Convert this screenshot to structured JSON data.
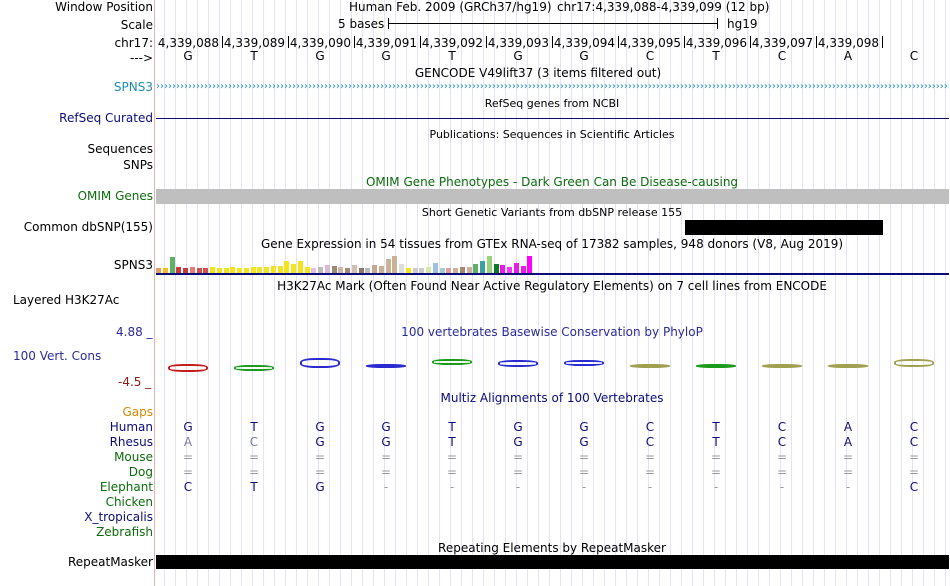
{
  "ruler": {
    "window_label": "Window Position",
    "assembly": "Human Feb. 2009 (GRCh37/hg19)",
    "position": "chr17:4,339,088-4,339,099 (12 bp)",
    "scale_label": "Scale",
    "scale_text": "5 bases",
    "scale_db": "hg19",
    "chrom_label": "chr17:",
    "coords": [
      "4,339,088",
      "4,339,089",
      "4,339,090",
      "4,339,091",
      "4,339,092",
      "4,339,093",
      "4,339,094",
      "4,339,095",
      "4,339,096",
      "4,339,097",
      "4,339,098"
    ],
    "strand_label": "--->",
    "bases": [
      "G",
      "T",
      "G",
      "G",
      "T",
      "G",
      "G",
      "C",
      "T",
      "C",
      "A",
      "C"
    ]
  },
  "tracks": {
    "gencode": {
      "title": "GENCODE V49lift37 (3 items filtered out)",
      "label": "SPNS3",
      "color": "#1f8bb5"
    },
    "refseq": {
      "title": "RefSeq genes from NCBI",
      "label": "RefSeq Curated",
      "color": "#0c0c78"
    },
    "publications": {
      "title": "Publications: Sequences in Scientific Articles",
      "label1": "Sequences",
      "label2": "SNPs"
    },
    "omim": {
      "title": "OMIM Gene Phenotypes - Dark Green Can Be Disease-causing",
      "label": "OMIM Genes",
      "color": "#0c6b0c"
    },
    "dbsnp": {
      "title": "Short Genetic Variants from dbSNP release 155",
      "label": "Common dbSNP(155)"
    },
    "gtex": {
      "title": "Gene Expression in 54 tissues from GTEx RNA-seq of 17382 samples, 948 donors (V8, Aug 2019)",
      "label": "SPNS3",
      "bar_heights": [
        0.3,
        0.3,
        0.95,
        0.35,
        0.3,
        0.35,
        0.3,
        0.3,
        0.35,
        0.3,
        0.3,
        0.35,
        0.3,
        0.3,
        0.35,
        0.35,
        0.35,
        0.4,
        0.4,
        0.7,
        0.55,
        0.7,
        0.35,
        0.3,
        0.35,
        0.45,
        0.4,
        0.35,
        0.3,
        0.45,
        0.3,
        0.3,
        0.45,
        0.4,
        0.85,
        1.0,
        0.55,
        0.3,
        0.3,
        0.3,
        0.35,
        0.6,
        0.3,
        0.3,
        0.3,
        0.35,
        0.35,
        0.5,
        0.7,
        1.0,
        0.5,
        0.45,
        0.35,
        0.6,
        0.4,
        1.0
      ],
      "bar_colors": [
        "#e2a068",
        "#f5bd28",
        "#5fb063",
        "#c53b3b",
        "#c53b3b",
        "#e87a7a",
        "#d05050",
        "#d05050",
        "#f2e51e",
        "#f2e51e",
        "#f2e51e",
        "#f2e51e",
        "#f2e51e",
        "#f2e51e",
        "#f2e51e",
        "#f2e51e",
        "#f2e51e",
        "#f2e51e",
        "#f2e51e",
        "#f2e51e",
        "#f2e51e",
        "#f2e51e",
        "#f2e51e",
        "#e6c1d6",
        "#bbbbbb",
        "#d9b9d2",
        "#9a8a7a",
        "#c9b9ad",
        "#a58a72",
        "#cfc0b3",
        "#8f7a6a",
        "#bbbbbb",
        "#c6a88e",
        "#c9b296",
        "#c9b296",
        "#c9b296",
        "#dddddd",
        "#f2e51e",
        "#cccccc",
        "#cccccc",
        "#d7e8a8",
        "#a0c0e0",
        "#a0d0d0",
        "#e39d9d",
        "#c9b296",
        "#a58a72",
        "#cdb0a0",
        "#5fb063",
        "#3d9f9f",
        "#9bd17a",
        "#0b7a2b",
        "#e51ee5",
        "#ff33ff",
        "#e51ee5",
        "#e51ee5",
        "#ff00ff"
      ]
    },
    "h3k27ac": {
      "title": "H3K27Ac Mark (Often Found Near Active Regulatory Elements) on 7 cell lines from ENCODE",
      "label": "Layered H3K27Ac"
    },
    "phylop": {
      "title": "100 vertebrates Basewise Conservation by PhyloP",
      "label": "100 Vert. Cons",
      "max": "4.88 _",
      "min": "-4.5 _",
      "color": "#2b2b9a"
    },
    "multiz": {
      "title": "Multiz Alignments of 100 Vertebrates",
      "species": [
        {
          "name": "Gaps",
          "color": "#d88b00",
          "seq": [
            "",
            "",
            "",
            "",
            "",
            "",
            "",
            "",
            "",
            "",
            "",
            ""
          ]
        },
        {
          "name": "Human",
          "color": "#0c0c78",
          "seq": [
            "G",
            "T",
            "G",
            "G",
            "T",
            "G",
            "G",
            "C",
            "T",
            "C",
            "A",
            "C"
          ]
        },
        {
          "name": "Rhesus",
          "color": "#0c0c78",
          "seq": [
            "A",
            "C",
            "G",
            "G",
            "T",
            "G",
            "G",
            "C",
            "T",
            "C",
            "A",
            "C"
          ]
        },
        {
          "name": "Mouse",
          "color": "#0c6b0c",
          "seq": [
            "=",
            "=",
            "=",
            "=",
            "=",
            "=",
            "=",
            "=",
            "=",
            "=",
            "=",
            "="
          ]
        },
        {
          "name": "Dog",
          "color": "#0c6b0c",
          "seq": [
            "=",
            "=",
            "=",
            "=",
            "=",
            "=",
            "=",
            "=",
            "=",
            "=",
            "=",
            "="
          ]
        },
        {
          "name": "Elephant",
          "color": "#0c6b0c",
          "seq": [
            "C",
            "T",
            "G",
            "-",
            "-",
            "-",
            "-",
            "-",
            "-",
            "-",
            "-",
            "C"
          ]
        },
        {
          "name": "Chicken",
          "color": "#0c6b0c",
          "seq": [
            "",
            "",
            "",
            "",
            "",
            "",
            "",
            "",
            "",
            "",
            "",
            ""
          ]
        },
        {
          "name": "X_tropicalis",
          "color": "#0c0c78",
          "seq": [
            "",
            "",
            "",
            "",
            "",
            "",
            "",
            "",
            "",
            "",
            "",
            ""
          ]
        },
        {
          "name": "Zebrafish",
          "color": "#0c6b0c",
          "seq": [
            "",
            "",
            "",
            "",
            "",
            "",
            "",
            "",
            "",
            "",
            "",
            ""
          ]
        }
      ]
    },
    "repeatmasker": {
      "title": "Repeating Elements by RepeatMasker",
      "label": "RepeatMasker"
    }
  }
}
